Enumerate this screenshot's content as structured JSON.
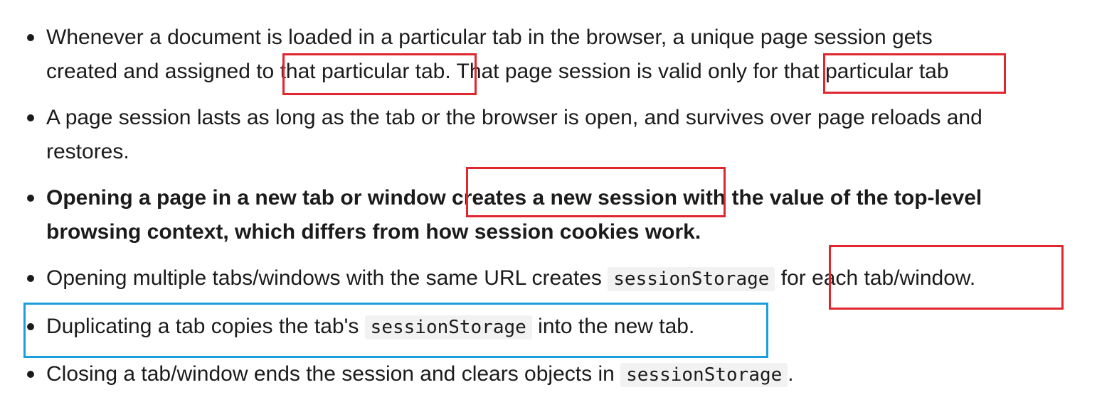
{
  "bullets": [
    {
      "line1": "Whenever a document is loaded in a particular tab in the browser, a unique page session gets",
      "line2": "created and assigned to that particular tab. That page session is valid only for that particular tab"
    },
    {
      "line1": "A page session lasts as long as the tab or the browser is open, and survives over page reloads and",
      "line2": "restores."
    },
    {
      "line1": "Opening a page in a new tab or window creates a new session with the value of the top-level",
      "line2": "browsing context, which differs from how session cookies work."
    },
    {
      "before": "Opening multiple tabs/windows with the same URL creates ",
      "code": "sessionStorage",
      "after": " for each tab/window."
    },
    {
      "before": "Duplicating a tab copies the tab's ",
      "code": "sessionStorage",
      "after": " into the new tab."
    },
    {
      "before": "Closing a tab/window ends the session and clears objects in ",
      "code": "sessionStorage",
      "after": "."
    }
  ],
  "colors": {
    "highlight_red": "#e0262e",
    "highlight_blue": "#1a9fdc",
    "text": "#1b1b1b",
    "code_background": "#f2f2f2"
  }
}
